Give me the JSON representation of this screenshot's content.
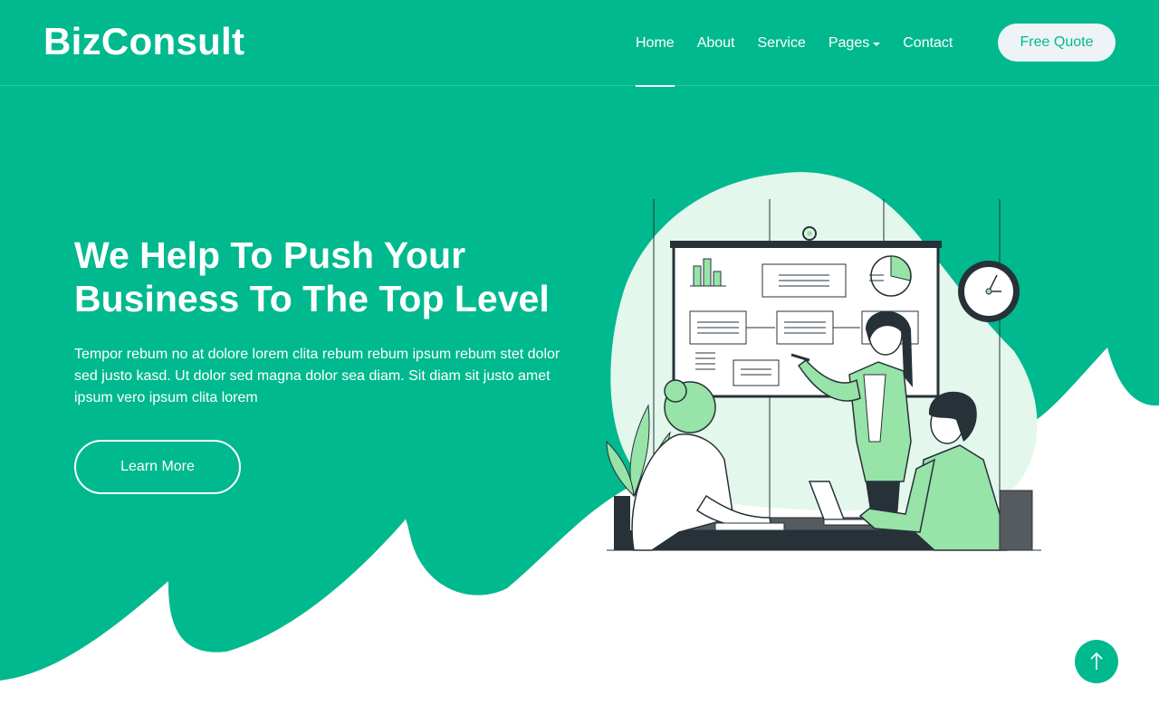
{
  "brand": {
    "name": "BizConsult"
  },
  "nav": {
    "items": [
      {
        "label": "Home",
        "active": true
      },
      {
        "label": "About"
      },
      {
        "label": "Service"
      },
      {
        "label": "Pages",
        "dropdown": true
      },
      {
        "label": "Contact"
      }
    ],
    "cta": "Free Quote"
  },
  "hero": {
    "title_line1": "We Help To Push Your",
    "title_line2": "Business To The Top Level",
    "description": "Tempor rebum no at dolore lorem clita rebum rebum ipsum rebum stet dolor sed justo kasd. Ut dolor sed magna dolor sea diam. Sit diam sit justo amet ipsum vero ipsum clita lorem",
    "button": "Learn More"
  },
  "icons": {
    "back_to_top": "arrow-up-icon",
    "dropdown": "caret-down-icon",
    "illustration": "team-meeting-illustration"
  },
  "colors": {
    "primary": "#00B98E",
    "light_green": "#E3F7EC",
    "figure_green": "#97E3A8",
    "dark": "#263238",
    "white": "#FFFFFF"
  }
}
